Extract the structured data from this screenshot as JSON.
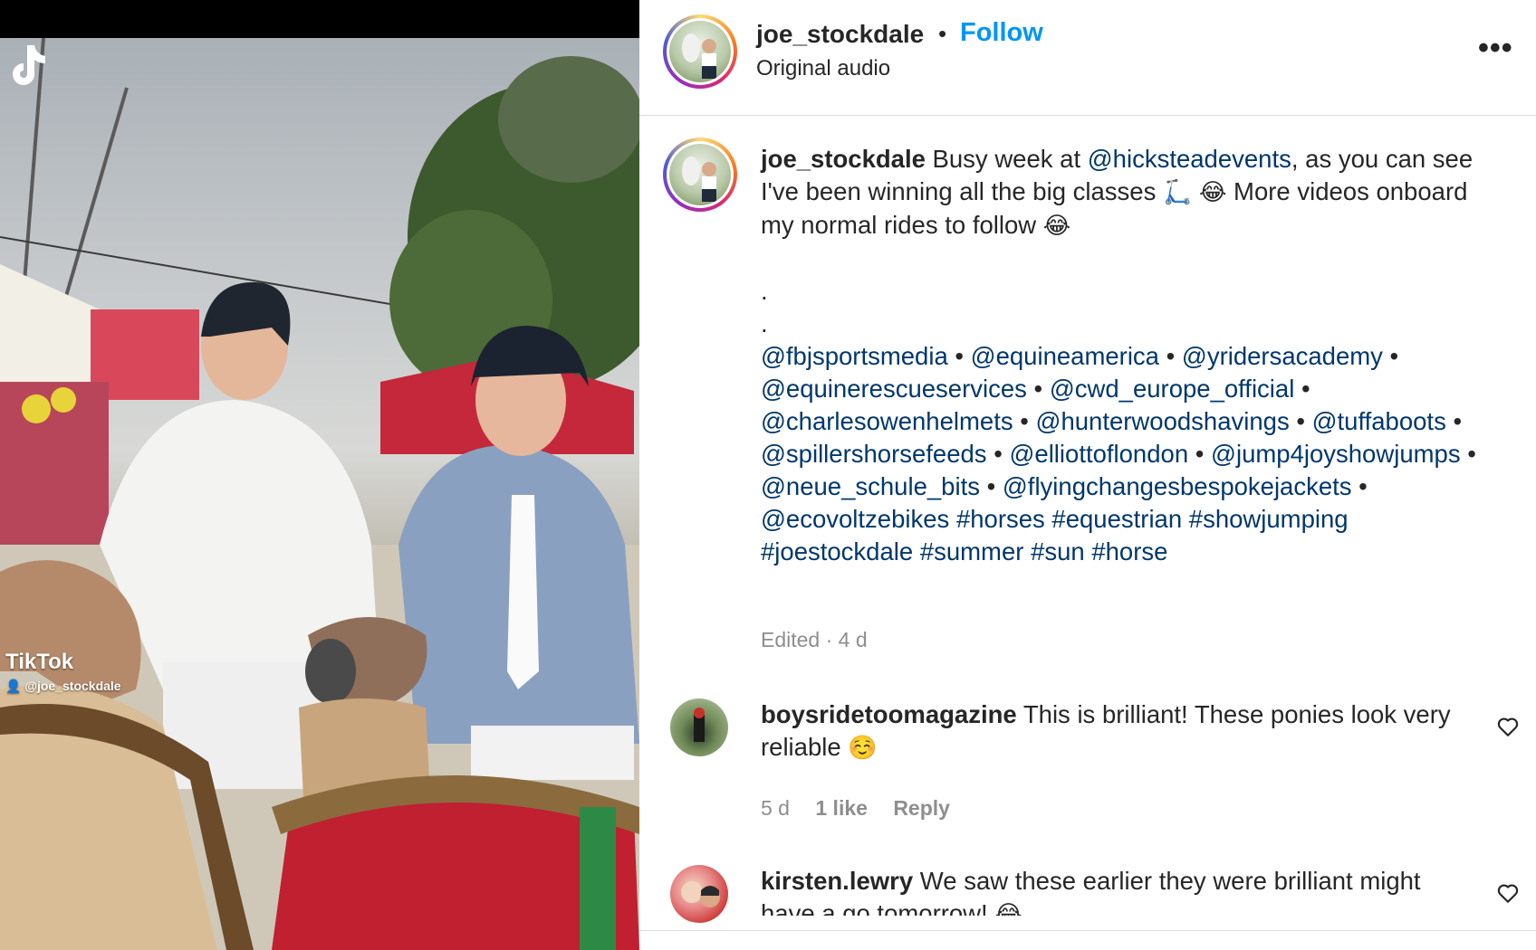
{
  "media": {
    "tiktok_label": "TikTok",
    "tiktok_handle": "@joe_stockdale"
  },
  "header": {
    "username": "joe_stockdale",
    "separator": "•",
    "follow_label": "Follow",
    "audio_label": "Original audio",
    "more_label": "•••"
  },
  "caption": {
    "username": "joe_stockdale",
    "text_1": " Busy week at ",
    "mention_1": "@hicksteadevents",
    "text_2": ", as you can see I've been winning all the big classes ",
    "emoji_scooter": "🛴",
    "emoji_laugh_1": "😂",
    "text_3": " More videos onboard my normal rides to follow ",
    "emoji_laugh_2": "😂",
    "dot_1": ".",
    "dot_2": ".",
    "mentions": [
      "@fbjsportsmedia",
      "@equineamerica",
      "@yridersacademy",
      "@equinerescueservices",
      "@cwd_europe_official",
      "@charlesowenhelmets",
      "@hunterwoodshavings",
      "@tuffaboots",
      "@spillershorsefeeds",
      "@elliottoflondon",
      "@jump4joyshowjumps",
      "@neue_schule_bits",
      "@flyingchangesbespokejackets",
      "@ecovoltzebikes"
    ],
    "hashtags": [
      "#horses",
      "#equestrian",
      "#showjumping",
      "#joestockdale",
      "#summer",
      "#sun",
      "#horse"
    ],
    "edited": "Edited · 4 d"
  },
  "comments": [
    {
      "username": "boysridetoomagazine",
      "text": " This is brilliant! These ponies look very reliable ",
      "emoji": "☺️",
      "age": "5 d",
      "likes": "1 like",
      "reply": "Reply"
    },
    {
      "username": "kirsten.lewry",
      "text": " We saw these earlier they were brilliant might have a go tomorrow! ",
      "emoji": "😂"
    }
  ]
}
